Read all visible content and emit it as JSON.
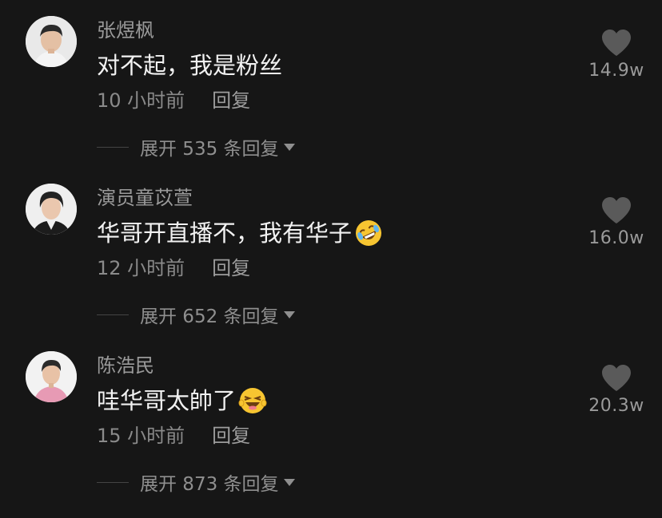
{
  "comments": [
    {
      "username": "张煜枫",
      "text": "对不起，我是粉丝",
      "emoji": "",
      "time": "10 小时前",
      "reply_label": "回复",
      "expand_label": "展开 535 条回复",
      "likes": "14.9w"
    },
    {
      "username": "演员童苡萱",
      "text": "华哥开直播不，我有华子",
      "emoji": "rofl-emoji",
      "time": "12 小时前",
      "reply_label": "回复",
      "expand_label": "展开 652 条回复",
      "likes": "16.0w"
    },
    {
      "username": "陈浩民",
      "text": "哇华哥太帥了",
      "emoji": "wink-laugh-emoji",
      "time": "15 小时前",
      "reply_label": "回复",
      "expand_label": "展开 873 条回复",
      "likes": "20.3w"
    }
  ],
  "colors": {
    "background": "#161616",
    "username": "#9a9a9a",
    "text": "#f2f2f2",
    "meta": "#8a8a8a",
    "heart": "#5a5a5a"
  }
}
